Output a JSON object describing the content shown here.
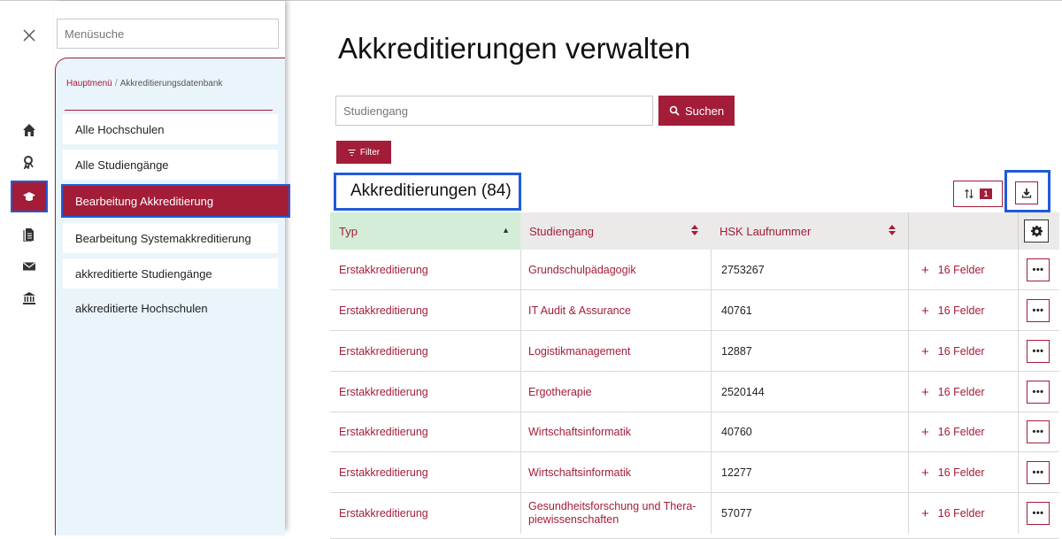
{
  "menu": {
    "search_placeholder": "Menüsuche",
    "breadcrumb_root": "Hauptmenü",
    "breadcrumb_separator": "/",
    "breadcrumb_current": "Akkreditierungsdatenbank",
    "items": [
      {
        "label": "Alle Hochschulen"
      },
      {
        "label": "Alle Studiengänge"
      },
      {
        "label": "Bearbeitung Akkreditierung"
      },
      {
        "label": "Bearbeitung Systemakkreditierung"
      },
      {
        "label": "akkreditierte Studiengänge"
      },
      {
        "label": "akkreditierte Hochschulen"
      }
    ]
  },
  "rail": {
    "icons": [
      "home-icon",
      "award-icon",
      "graduation-cap-icon",
      "document-icon",
      "envelope-icon",
      "institution-icon"
    ]
  },
  "page": {
    "title": "Akkreditierungen verwalten",
    "search_placeholder": "Studiengang",
    "search_button": "Suchen",
    "filter_button": "Filter",
    "section_title": "Akkreditierungen (84)",
    "sort_badge": "1"
  },
  "table": {
    "columns": [
      "Typ",
      "Studiengang",
      "HSK Laufnummer"
    ],
    "rows": [
      {
        "typ": "Erstakkreditierung",
        "studiengang": "Grundschulpädagogik",
        "hsk": "2753267",
        "felder": "16 Felder"
      },
      {
        "typ": "Erstakkreditierung",
        "studiengang": "IT Audit & Assurance",
        "hsk": "40761",
        "felder": "16 Felder"
      },
      {
        "typ": "Erstakkreditierung",
        "studiengang": "Logistikmanagement",
        "hsk": "12887",
        "felder": "16 Felder"
      },
      {
        "typ": "Erstakkreditierung",
        "studiengang": "Ergotherapie",
        "hsk": "2520144",
        "felder": "16 Felder"
      },
      {
        "typ": "Erstakkreditierung",
        "studiengang": "Wirtschaftsinformatik",
        "hsk": "40760",
        "felder": "16 Felder"
      },
      {
        "typ": "Erstakkreditierung",
        "studiengang": "Wirtschaftsinformatik",
        "hsk": "12277",
        "felder": "16 Felder"
      },
      {
        "typ": "Erstakkreditierung",
        "studiengang": "Gesundheitsforschung und Thera-piewissenschaften",
        "hsk": "57077",
        "felder": "16 Felder"
      }
    ]
  },
  "colors": {
    "brand": "#a31d38",
    "highlight": "#1f5bd9",
    "menu_bg": "#e9f4fb",
    "sorted_column_bg": "#d3edd8"
  }
}
